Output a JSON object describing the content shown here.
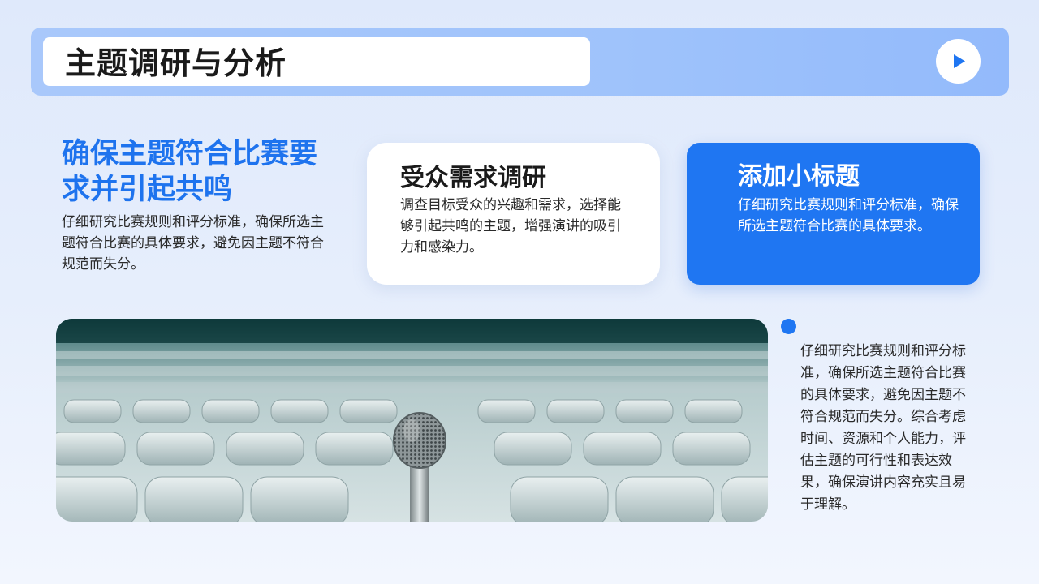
{
  "header": {
    "title": "主题调研与分析",
    "play_icon": "play-icon"
  },
  "main": {
    "heading": "确保主题符合比赛要求并引起共鸣",
    "body": "仔细研究比赛规则和评分标准，确保所选主题符合比赛的具体要求，避免因主题不符合规范而失分。"
  },
  "cards": [
    {
      "title": "受众需求调研",
      "body": "调查目标受众的兴趣和需求，选择能够引起共鸣的主题，增强演讲的吸引力和感染力。"
    },
    {
      "title": "添加小标题",
      "body": "仔细研究比赛规则和评分标准，确保所选主题符合比赛的具体要求。"
    }
  ],
  "side": {
    "text": "仔细研究比赛规则和评分标准，确保所选主题符合比赛的具体要求，避免因主题不符合规范而失分。综合考虑时间、资源和个人能力，评估主题的可行性和表达效果，确保演讲内容充实且易于理解。"
  },
  "colors": {
    "accent": "#1f76f2",
    "heading_blue": "#1e73ee",
    "header_bar": "#9fc3fb"
  }
}
